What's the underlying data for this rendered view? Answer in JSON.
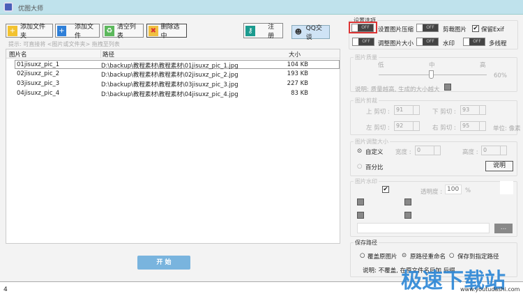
{
  "window": {
    "title": "优图大师"
  },
  "toolbar": {
    "add_folder": "添加文件夹",
    "add_file": "添加文件",
    "clear_list": "清空列表",
    "delete_selected": "删除选中",
    "register": "注册",
    "qq": "QQ交谈"
  },
  "hint": "提示: 可直接将 <图片或文件夹> 拖拽至列表",
  "list": {
    "columns": [
      "图片名",
      "路径",
      "大小"
    ],
    "rows": [
      {
        "name": "01jisuxz_pic_1",
        "path": "D:\\backup\\教程素材\\教程素材\\01jisuxz_pic_1.jpg",
        "size": "104 KB"
      },
      {
        "name": "02jisuxz_pic_2",
        "path": "D:\\backup\\教程素材\\教程素材\\02jisuxz_pic_2.jpg",
        "size": "193 KB"
      },
      {
        "name": "03jisuxz_pic_3",
        "path": "D:\\backup\\教程素材\\教程素材\\03jisuxz_pic_3.jpg",
        "size": "227 KB"
      },
      {
        "name": "04jisuxz_pic_4",
        "path": "D:\\backup\\教程素材\\教程素材\\04jisuxz_pic_4.jpg",
        "size": "83 KB"
      }
    ]
  },
  "start": "开 始",
  "status": "4",
  "settings": {
    "title": "设置选项",
    "off": "OFF",
    "compress": "设置图片压缩",
    "crop": "剪裁图片",
    "exif": "保留Exif",
    "resize": "调整图片大小",
    "watermark": "水印",
    "multithread": "多线程"
  },
  "quality": {
    "title": "图片质量",
    "low": "低",
    "mid": "中",
    "high": "高",
    "value": "60%",
    "value_pct": 60,
    "note": "说明: 质量越高, 生成的大小越大"
  },
  "crop": {
    "title": "图片剪裁",
    "top_label": "上 剪切 :",
    "top": "91",
    "bottom_label": "下 剪切 :",
    "bottom": "93",
    "left_label": "左 剪切 :",
    "left": "92",
    "right_label": "右 剪切 :",
    "right": "95",
    "unit": "单位: 像素"
  },
  "resize": {
    "title": "图片调整大小",
    "custom": "自定义",
    "width_label": "宽度 :",
    "width": "0",
    "height_label": "高度 :",
    "height": "0",
    "percent": "百分比",
    "help": "说明"
  },
  "wm": {
    "title": "图片水印",
    "opacity_label": "透明度 :",
    "opacity": "100",
    "pct": "%",
    "browse": "..."
  },
  "save": {
    "title": "保存路径",
    "overwrite": "覆盖原图片",
    "rename": "原路径重命名",
    "custom": "保存到指定路径",
    "note": "说明: 不覆盖, 在原文件名后加 后缀"
  },
  "watermark_logo": "极速下载站",
  "watermark_url": "www.youtudashi.com"
}
